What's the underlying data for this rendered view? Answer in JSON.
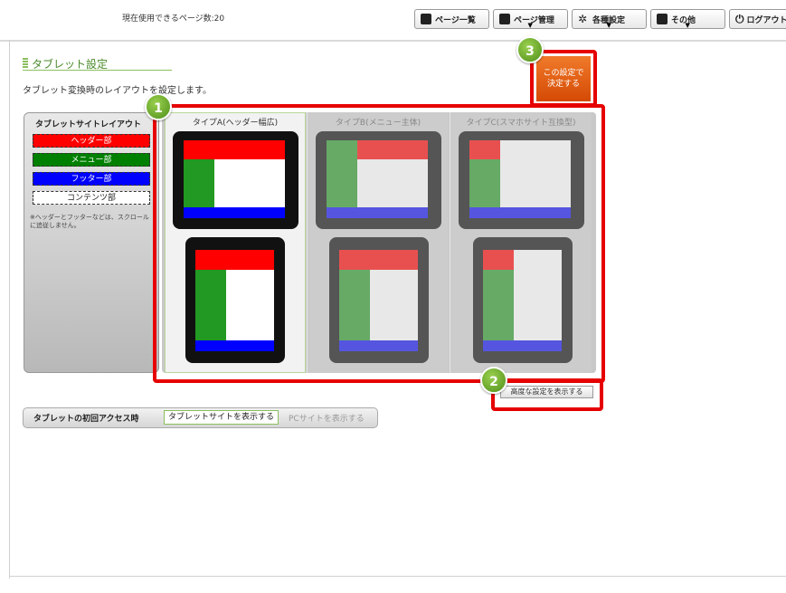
{
  "header": {
    "page_count": "現在使用できるページ数:20",
    "buttons": [
      {
        "label": "ページ一覧",
        "icon": "page-list-icon",
        "dropdown": false
      },
      {
        "label": "ページ管理",
        "icon": "page-manage-icon",
        "dropdown": true
      },
      {
        "label": "各種設定",
        "icon": "settings-gear-icon",
        "dropdown": true
      },
      {
        "label": "その他",
        "icon": "other-icon",
        "dropdown": true
      },
      {
        "label": "ログアウト",
        "icon": "power-icon",
        "dropdown": false
      }
    ]
  },
  "section": {
    "title": "タブレット設定",
    "description": "タブレット変換時のレイアウトを設定します。"
  },
  "legend": {
    "title": "タブレットサイトレイアウト",
    "items": [
      {
        "label": "ヘッダー部",
        "color": "#ff0000"
      },
      {
        "label": "メニュー部",
        "color": "#008000"
      },
      {
        "label": "フッター部",
        "color": "#0000ff"
      },
      {
        "label": "コンテンツ部",
        "color": "#ffffff"
      }
    ],
    "note": "※ヘッダーとフッターなどは、スクロールに追従しません。"
  },
  "layouts": {
    "types": [
      {
        "label": "タイプA(ヘッダー幅広)",
        "selected": true
      },
      {
        "label": "タイプB(メニュー主体)",
        "selected": false
      },
      {
        "label": "タイプC(スマホサイト互換型)",
        "selected": false
      }
    ]
  },
  "badges": [
    "1",
    "2",
    "3"
  ],
  "actions": {
    "decide_label_1": "この設定で",
    "decide_label_2": "決定する",
    "advanced_label": "高度な設定を表示する"
  },
  "first_access": {
    "label": "タブレットの初回アクセス時",
    "options": [
      "タブレットサイトを表示する",
      "PCサイトを表示する"
    ],
    "selected": 0
  },
  "colors": {
    "accent_green": "#8bbf5f",
    "annotation_red": "#e60000",
    "decide_orange": "#e8640f"
  }
}
